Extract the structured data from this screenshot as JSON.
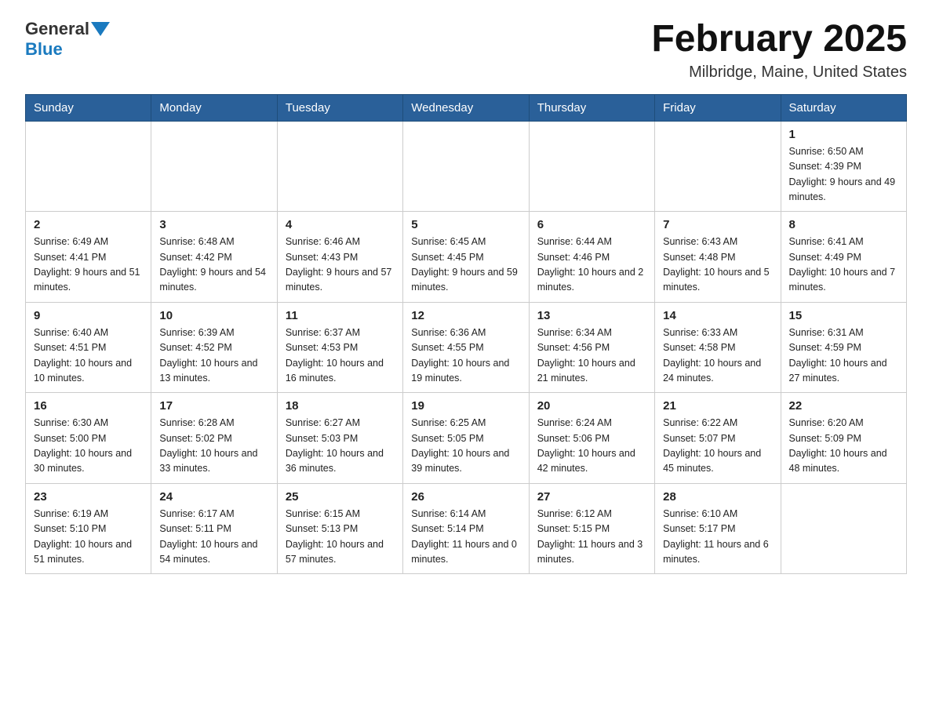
{
  "header": {
    "logo_general": "General",
    "logo_blue": "Blue",
    "title": "February 2025",
    "location": "Milbridge, Maine, United States"
  },
  "days_of_week": [
    "Sunday",
    "Monday",
    "Tuesday",
    "Wednesday",
    "Thursday",
    "Friday",
    "Saturday"
  ],
  "weeks": [
    [
      {
        "day": "",
        "info": ""
      },
      {
        "day": "",
        "info": ""
      },
      {
        "day": "",
        "info": ""
      },
      {
        "day": "",
        "info": ""
      },
      {
        "day": "",
        "info": ""
      },
      {
        "day": "",
        "info": ""
      },
      {
        "day": "1",
        "info": "Sunrise: 6:50 AM\nSunset: 4:39 PM\nDaylight: 9 hours and 49 minutes."
      }
    ],
    [
      {
        "day": "2",
        "info": "Sunrise: 6:49 AM\nSunset: 4:41 PM\nDaylight: 9 hours and 51 minutes."
      },
      {
        "day": "3",
        "info": "Sunrise: 6:48 AM\nSunset: 4:42 PM\nDaylight: 9 hours and 54 minutes."
      },
      {
        "day": "4",
        "info": "Sunrise: 6:46 AM\nSunset: 4:43 PM\nDaylight: 9 hours and 57 minutes."
      },
      {
        "day": "5",
        "info": "Sunrise: 6:45 AM\nSunset: 4:45 PM\nDaylight: 9 hours and 59 minutes."
      },
      {
        "day": "6",
        "info": "Sunrise: 6:44 AM\nSunset: 4:46 PM\nDaylight: 10 hours and 2 minutes."
      },
      {
        "day": "7",
        "info": "Sunrise: 6:43 AM\nSunset: 4:48 PM\nDaylight: 10 hours and 5 minutes."
      },
      {
        "day": "8",
        "info": "Sunrise: 6:41 AM\nSunset: 4:49 PM\nDaylight: 10 hours and 7 minutes."
      }
    ],
    [
      {
        "day": "9",
        "info": "Sunrise: 6:40 AM\nSunset: 4:51 PM\nDaylight: 10 hours and 10 minutes."
      },
      {
        "day": "10",
        "info": "Sunrise: 6:39 AM\nSunset: 4:52 PM\nDaylight: 10 hours and 13 minutes."
      },
      {
        "day": "11",
        "info": "Sunrise: 6:37 AM\nSunset: 4:53 PM\nDaylight: 10 hours and 16 minutes."
      },
      {
        "day": "12",
        "info": "Sunrise: 6:36 AM\nSunset: 4:55 PM\nDaylight: 10 hours and 19 minutes."
      },
      {
        "day": "13",
        "info": "Sunrise: 6:34 AM\nSunset: 4:56 PM\nDaylight: 10 hours and 21 minutes."
      },
      {
        "day": "14",
        "info": "Sunrise: 6:33 AM\nSunset: 4:58 PM\nDaylight: 10 hours and 24 minutes."
      },
      {
        "day": "15",
        "info": "Sunrise: 6:31 AM\nSunset: 4:59 PM\nDaylight: 10 hours and 27 minutes."
      }
    ],
    [
      {
        "day": "16",
        "info": "Sunrise: 6:30 AM\nSunset: 5:00 PM\nDaylight: 10 hours and 30 minutes."
      },
      {
        "day": "17",
        "info": "Sunrise: 6:28 AM\nSunset: 5:02 PM\nDaylight: 10 hours and 33 minutes."
      },
      {
        "day": "18",
        "info": "Sunrise: 6:27 AM\nSunset: 5:03 PM\nDaylight: 10 hours and 36 minutes."
      },
      {
        "day": "19",
        "info": "Sunrise: 6:25 AM\nSunset: 5:05 PM\nDaylight: 10 hours and 39 minutes."
      },
      {
        "day": "20",
        "info": "Sunrise: 6:24 AM\nSunset: 5:06 PM\nDaylight: 10 hours and 42 minutes."
      },
      {
        "day": "21",
        "info": "Sunrise: 6:22 AM\nSunset: 5:07 PM\nDaylight: 10 hours and 45 minutes."
      },
      {
        "day": "22",
        "info": "Sunrise: 6:20 AM\nSunset: 5:09 PM\nDaylight: 10 hours and 48 minutes."
      }
    ],
    [
      {
        "day": "23",
        "info": "Sunrise: 6:19 AM\nSunset: 5:10 PM\nDaylight: 10 hours and 51 minutes."
      },
      {
        "day": "24",
        "info": "Sunrise: 6:17 AM\nSunset: 5:11 PM\nDaylight: 10 hours and 54 minutes."
      },
      {
        "day": "25",
        "info": "Sunrise: 6:15 AM\nSunset: 5:13 PM\nDaylight: 10 hours and 57 minutes."
      },
      {
        "day": "26",
        "info": "Sunrise: 6:14 AM\nSunset: 5:14 PM\nDaylight: 11 hours and 0 minutes."
      },
      {
        "day": "27",
        "info": "Sunrise: 6:12 AM\nSunset: 5:15 PM\nDaylight: 11 hours and 3 minutes."
      },
      {
        "day": "28",
        "info": "Sunrise: 6:10 AM\nSunset: 5:17 PM\nDaylight: 11 hours and 6 minutes."
      },
      {
        "day": "",
        "info": ""
      }
    ]
  ]
}
